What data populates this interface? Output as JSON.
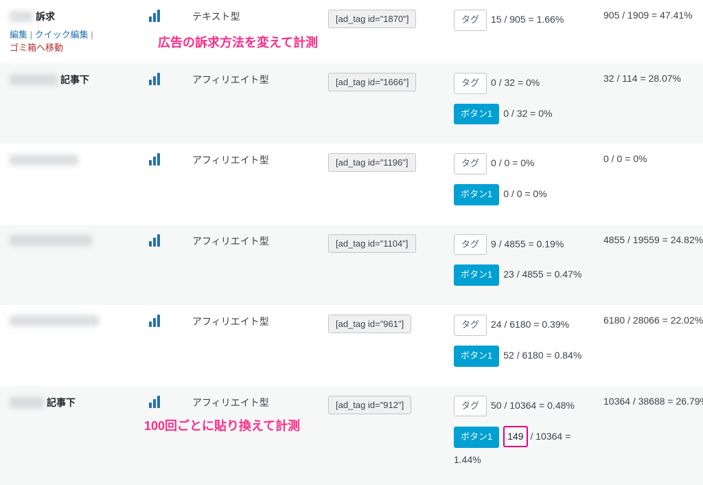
{
  "annotations": {
    "top": "広告の訴求方法を変えて計測",
    "bottom": "100回ごとに貼り換えて計測"
  },
  "row_actions": {
    "edit": "編集",
    "quick": "クイック編集",
    "trash": "ゴミ箱へ移動"
  },
  "chips": {
    "tag": "タグ",
    "button1": "ボタン1"
  },
  "rows": [
    {
      "title_suffix": "訴求",
      "blur_w": 34,
      "show_actions": true,
      "type": "テキスト型",
      "shortcode": "[ad_tag id=\"1870\"]",
      "metrics": [
        {
          "chip": "tag",
          "text": "15 / 905 = 1.66%"
        }
      ],
      "stats": "905 / 1909 = 47.41%"
    },
    {
      "title_suffix": "記事下",
      "blur_w": 70,
      "type": "アフィリエイト型",
      "shortcode": "[ad_tag id=\"1666\"]",
      "metrics": [
        {
          "chip": "tag",
          "text": "0 / 32 = 0%"
        },
        {
          "chip": "button1",
          "text": "0 / 32 = 0%"
        }
      ],
      "stats": "32 / 114 = 28.07%"
    },
    {
      "title_suffix": "",
      "blur_w": 100,
      "type": "アフィリエイト型",
      "shortcode": "[ad_tag id=\"1196\"]",
      "metrics": [
        {
          "chip": "tag",
          "text": "0 / 0 = 0%"
        },
        {
          "chip": "button1",
          "text": "0 / 0 = 0%"
        }
      ],
      "stats": "0 / 0 = 0%"
    },
    {
      "title_suffix": "",
      "blur_w": 120,
      "type": "アフィリエイト型",
      "shortcode": "[ad_tag id=\"1104\"]",
      "metrics": [
        {
          "chip": "tag",
          "text": "9 / 4855 = 0.19%"
        },
        {
          "chip": "button1",
          "text": "23 / 4855 = 0.47%"
        }
      ],
      "stats": "4855 / 19559 = 24.82%"
    },
    {
      "title_suffix": "",
      "blur_w": 130,
      "type": "アフィリエイト型",
      "shortcode": "[ad_tag id=\"961\"]",
      "metrics": [
        {
          "chip": "tag",
          "text": "24 / 6180 = 0.39%"
        },
        {
          "chip": "button1",
          "text": "52 / 6180 = 0.84%"
        }
      ],
      "stats": "6180 / 28066 = 22.02%"
    },
    {
      "title_suffix": "記事下",
      "blur_w": 50,
      "type": "アフィリエイト型",
      "shortcode": "[ad_tag id=\"912\"]",
      "metrics": [
        {
          "chip": "tag",
          "text": "50 / 10364 = 0.48%"
        },
        {
          "chip": "button1",
          "text_pre": "",
          "highlight": "149",
          "text_post": " / 10364 = 1.44%"
        }
      ],
      "stats": "10364 / 38688 = 26.79%"
    }
  ]
}
